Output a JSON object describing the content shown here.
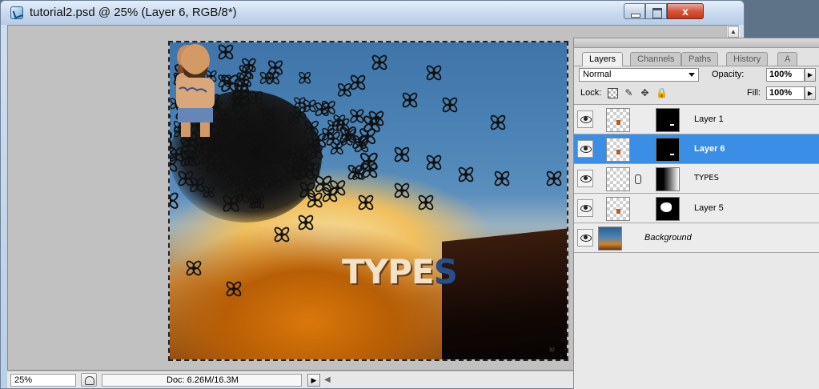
{
  "window": {
    "title": "tutorial2.psd @ 25% (Layer 6, RGB/8*)",
    "close_glyph": "x"
  },
  "canvas": {
    "text": "TYPES",
    "text_first": "TYP",
    "text_mid": "E",
    "text_last": "S",
    "page_number": "32"
  },
  "statusbar": {
    "zoom": "25%",
    "doc_size": "Doc: 6.26M/16.3M",
    "arrow": "▶",
    "scroll_left": "◀"
  },
  "panel": {
    "tabs": [
      "Layers",
      "Channels",
      "Paths",
      "History",
      "A"
    ],
    "blend_mode": "Normal",
    "opacity_label": "Opacity:",
    "opacity_value": "100%",
    "lock_label": "Lock:",
    "fill_label": "Fill:",
    "fill_value": "100%",
    "spin_glyph": "▶",
    "lock_icons": {
      "move": "✥",
      "paint": "✎",
      "all": "🔒"
    },
    "layers": [
      {
        "name": "Layer 1",
        "selected": false,
        "italic": false
      },
      {
        "name": "Layer 6",
        "selected": true,
        "italic": false
      },
      {
        "name": "TYPES",
        "selected": false,
        "italic": false
      },
      {
        "name": "Layer 5",
        "selected": false,
        "italic": false
      },
      {
        "name": "Background",
        "selected": false,
        "italic": true
      }
    ]
  },
  "colors": {
    "selection": "#3a8ee6",
    "close_button": "#c2381d"
  }
}
